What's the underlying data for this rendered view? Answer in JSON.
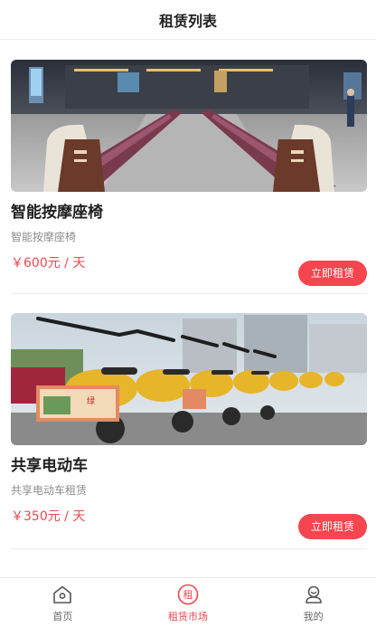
{
  "header": {
    "title": "租赁列表"
  },
  "products": [
    {
      "title": "智能按摩座椅",
      "subtitle": "智能按摩座椅",
      "price": "￥600元 / 天",
      "button_label": "立即租赁",
      "image_icon": "massage-chair-photo"
    },
    {
      "title": "共享电动车",
      "subtitle": "共享电动车租赁",
      "price": "￥350元 / 天",
      "button_label": "立即租赁",
      "image_icon": "electric-bike-photo"
    }
  ],
  "tabbar": {
    "items": [
      {
        "label": "首页",
        "icon": "home-icon",
        "active": false
      },
      {
        "label": "租赁市场",
        "icon": "rent-icon",
        "icon_char": "租",
        "active": true
      },
      {
        "label": "我的",
        "icon": "user-icon",
        "active": false
      }
    ]
  },
  "colors": {
    "accent": "#f0474e",
    "button": "#f5454e"
  }
}
